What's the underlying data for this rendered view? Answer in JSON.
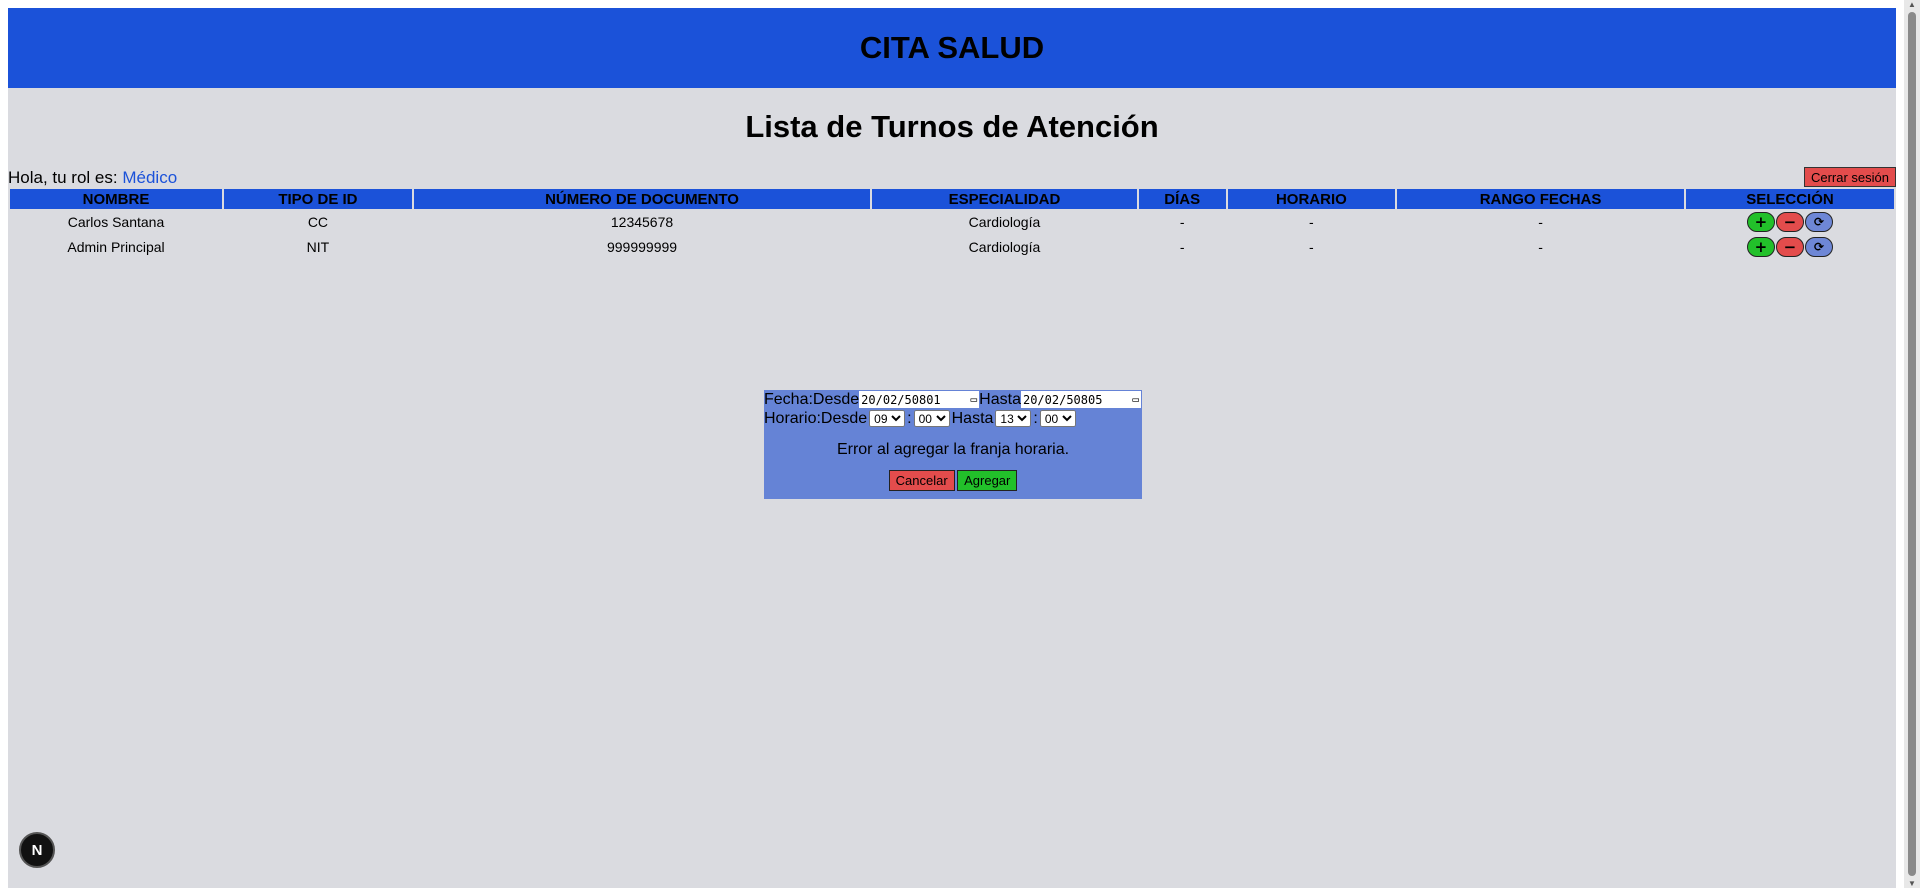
{
  "header": {
    "title": "CITA SALUD"
  },
  "page_title": "Lista de Turnos de Atención",
  "greeting": {
    "prefix": "Hola, tu rol es:",
    "role": "Médico"
  },
  "logout_label": "Cerrar sesión",
  "table": {
    "columns": [
      "NOMBRE",
      "TIPO DE ID",
      "NÚMERO DE DOCUMENTO",
      "ESPECIALIDAD",
      "DÍAS",
      "HORARIO",
      "RANGO FECHAS",
      "SELECCIÓN"
    ],
    "rows": [
      {
        "nombre": "Carlos Santana",
        "tipo_id": "CC",
        "documento": "12345678",
        "especialidad": "Cardiología",
        "dias": "-",
        "horario": "-",
        "rango": "-"
      },
      {
        "nombre": "Admin Principal",
        "tipo_id": "NIT",
        "documento": "999999999",
        "especialidad": "Cardiología",
        "dias": "-",
        "horario": "-",
        "rango": "-"
      }
    ],
    "actions": {
      "add": "+",
      "remove": "−",
      "refresh": "⟳"
    }
  },
  "modal": {
    "fecha_label": "Fecha:",
    "desde_label": "Desde",
    "hasta_label": "Hasta",
    "fecha_desde": "20/02/50801",
    "fecha_hasta": "20/02/50805",
    "horario_label": "Horario:",
    "hora_desde": "09",
    "min_desde": "00",
    "hora_hasta": "13",
    "min_hasta": "00",
    "sep": ":",
    "error": "Error al agregar la franja horaria.",
    "cancel": "Cancelar",
    "add": "Agregar"
  },
  "badge": "N",
  "icons": {
    "calendar": "calendar-icon",
    "refresh": "refresh-icon"
  },
  "colors": {
    "primary": "#1b52d9",
    "danger": "#e34c4c",
    "success": "#22c02a",
    "modal": "#6583d6"
  }
}
